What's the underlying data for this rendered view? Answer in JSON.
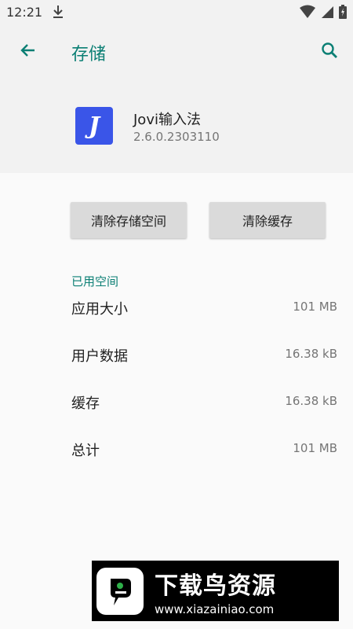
{
  "status_bar": {
    "time": "12:21",
    "icons": [
      "download-icon",
      "wifi-icon",
      "signal-icon",
      "battery-icon"
    ]
  },
  "app_bar": {
    "title": "存储",
    "back_icon": "arrow-back-icon",
    "search_icon": "search-icon",
    "accent_color": "#0b7f74"
  },
  "app_info": {
    "icon_letter": "J",
    "icon_color": "#3a55e8",
    "name": "Jovi输入法",
    "version": "2.6.0.2303110"
  },
  "actions": {
    "clear_storage_label": "清除存储空间",
    "clear_cache_label": "清除缓存"
  },
  "used_space": {
    "header": "已用空间",
    "rows": [
      {
        "label": "应用大小",
        "value": "101 MB"
      },
      {
        "label": "用户数据",
        "value": "16.38 kB"
      },
      {
        "label": "缓存",
        "value": "16.38 kB"
      },
      {
        "label": "总计",
        "value": "101 MB"
      }
    ]
  },
  "watermark": {
    "title": "下载鸟资源",
    "url": "www.xiazainiao.com"
  }
}
